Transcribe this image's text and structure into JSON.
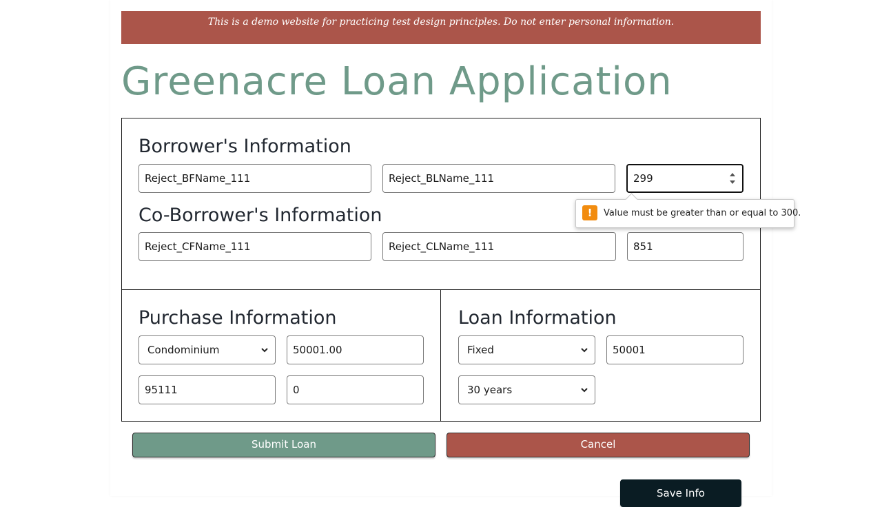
{
  "banner": {
    "text": "This is a demo website for practicing test design principles. Do not enter personal information."
  },
  "app": {
    "title": "Greenacre Loan Application"
  },
  "borrower": {
    "title": "Borrower's Information",
    "first_name": "Reject_BFName_111",
    "last_name": "Reject_BLName_111",
    "credit_score": "299"
  },
  "co_borrower": {
    "title": "Co-Borrower's Information",
    "first_name": "Reject_CFName_111",
    "last_name": "Reject_CLName_111",
    "credit_score": "851"
  },
  "validation": {
    "message": "Value must be greater than or equal to 300.",
    "icon": "warning-icon",
    "icon_glyph": "!"
  },
  "purchase": {
    "title": "Purchase Information",
    "property_type": "Condominium",
    "price": "50001.00",
    "zip": "95111",
    "down_payment": "0"
  },
  "loan": {
    "title": "Loan Information",
    "rate_type": "Fixed",
    "amount": "50001",
    "term": "30 years"
  },
  "buttons": {
    "submit": "Submit Loan",
    "cancel": "Cancel",
    "save": "Save Info"
  },
  "colors": {
    "banner": "#ab554a",
    "title": "#6f9a89",
    "submit": "#6f9a89",
    "cancel": "#ab554a",
    "save": "#0a1c23",
    "warning": "#f28c0f"
  }
}
